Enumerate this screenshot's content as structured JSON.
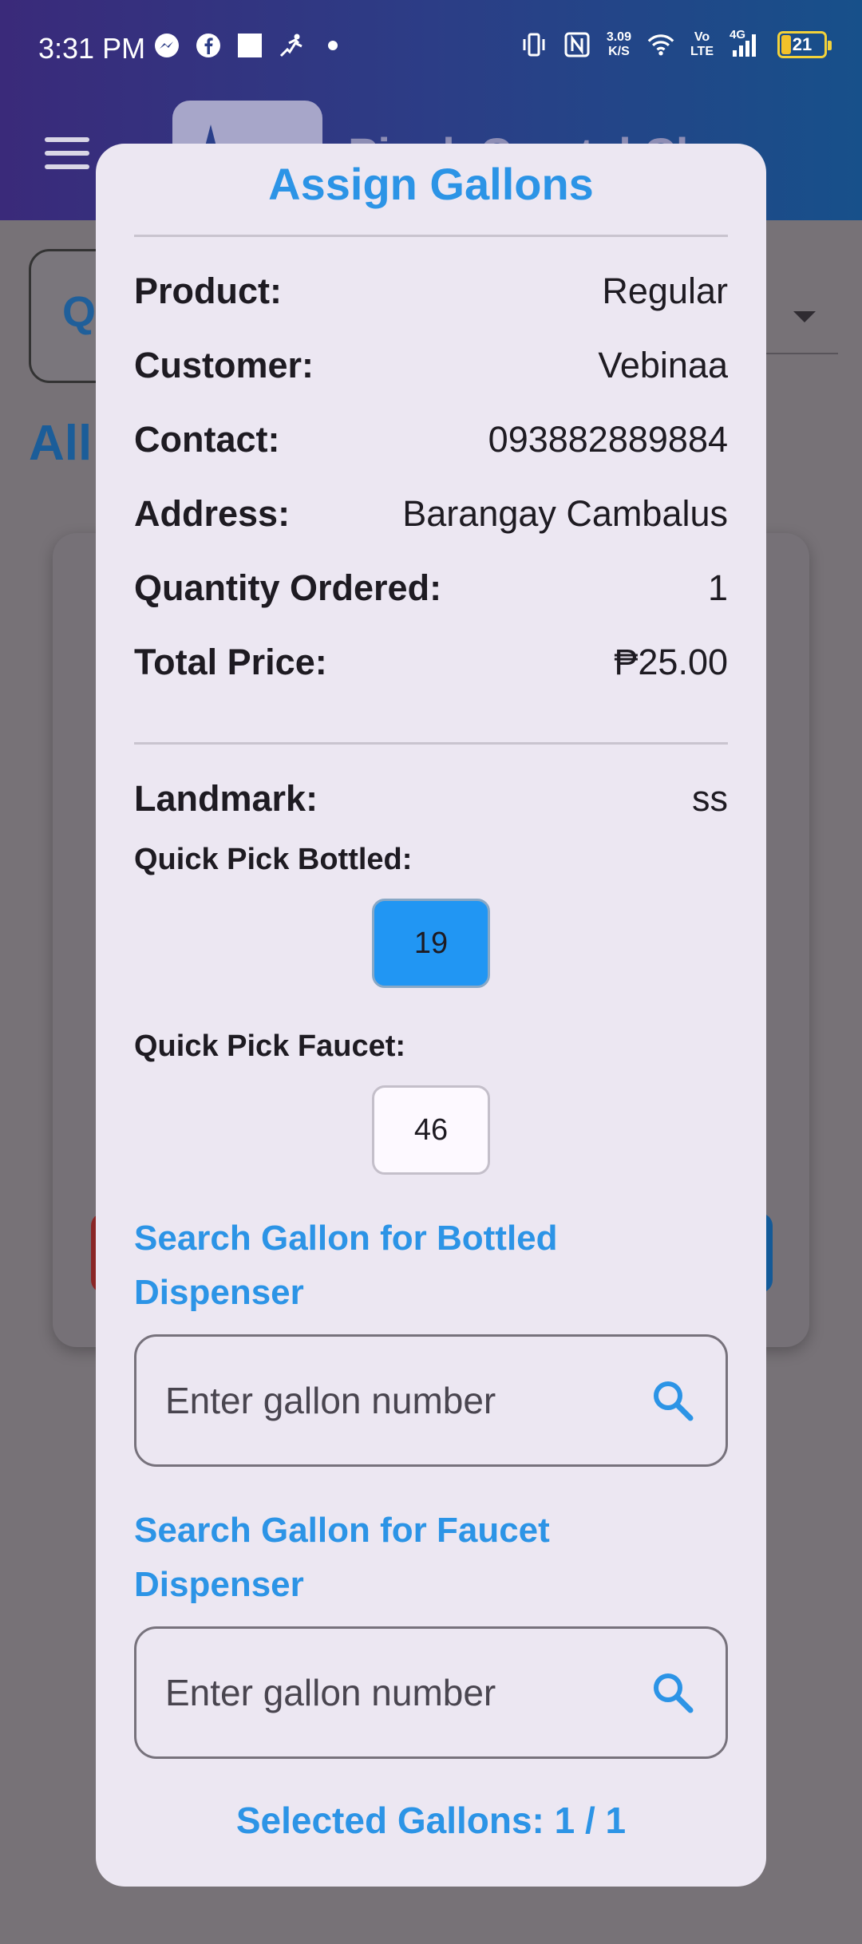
{
  "status_bar": {
    "time": "3:31 PM",
    "net_speed_value": "3.09",
    "net_speed_unit": "K/S",
    "volte_line1": "Vo",
    "volte_line2": "LTE",
    "network": "4G",
    "battery": "21",
    "left_icons": [
      "messenger-icon",
      "facebook-icon",
      "square-icon",
      "activity-icon",
      "dot-icon"
    ],
    "right_icons": [
      "vibrate-icon",
      "nfc-icon",
      "wifi-icon",
      "signal-icon",
      "battery-icon"
    ]
  },
  "app_bar": {
    "title": "Pinck Crystal Cl"
  },
  "background": {
    "heading": "All"
  },
  "dialog": {
    "title": "Assign Gallons",
    "rows": [
      {
        "label": "Product:",
        "value": "Regular"
      },
      {
        "label": "Customer:",
        "value": "Vebinaa"
      },
      {
        "label": "Contact:",
        "value": "093882889884"
      },
      {
        "label": "Address:",
        "value": "Barangay Cambalus"
      },
      {
        "label": "Quantity Ordered:",
        "value": "1"
      },
      {
        "label": "Total Price:",
        "value": "₱25.00"
      }
    ],
    "landmark": {
      "label": "Landmark:",
      "value": "ss"
    },
    "quick_pick_bottled": {
      "label": "Quick Pick Bottled:",
      "chip": "19",
      "selected": true
    },
    "quick_pick_faucet": {
      "label": "Quick Pick Faucet:",
      "chip": "46",
      "selected": false
    },
    "search_bottled": {
      "title": "Search Gallon for Bottled Dispenser",
      "placeholder": "Enter gallon number",
      "value": ""
    },
    "search_faucet": {
      "title": "Search Gallon for Faucet Dispenser",
      "placeholder": "Enter gallon number",
      "value": ""
    },
    "selected_count": "Selected Gallons: 1 / 1"
  },
  "colors": {
    "accent": "#2c94e6",
    "chip_selected": "#2196f3",
    "dialog_bg": "#ece7f2",
    "scrim": "#777277"
  }
}
